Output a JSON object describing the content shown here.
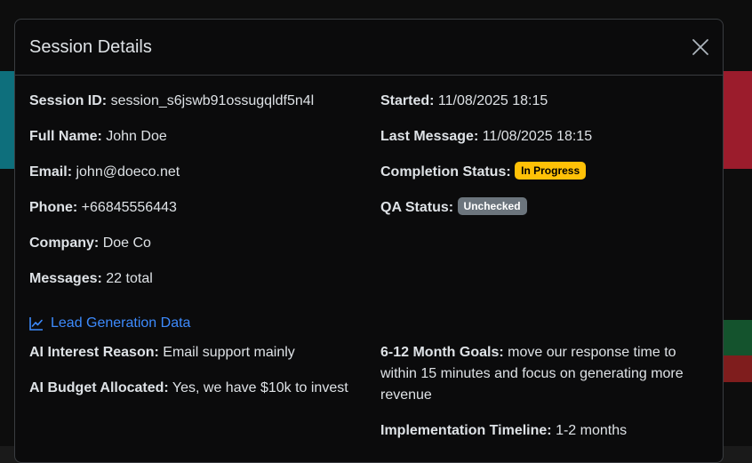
{
  "modal": {
    "title": "Session Details",
    "close_icon": "close-icon"
  },
  "session": {
    "id_label": "Session ID:",
    "id_value": "session_s6jswb91ossugqldf5n4l",
    "name_label": "Full Name:",
    "name_value": "John Doe",
    "email_label": "Email:",
    "email_value": "john@doeco.net",
    "phone_label": "Phone:",
    "phone_value": "+66845556443",
    "company_label": "Company:",
    "company_value": "Doe Co",
    "messages_label": "Messages:",
    "messages_value": "22 total",
    "started_label": "Started:",
    "started_value": "11/08/2025 18:15",
    "last_message_label": "Last Message:",
    "last_message_value": "11/08/2025 18:15",
    "completion_label": "Completion Status:",
    "completion_badge": "In Progress",
    "qa_label": "QA Status:",
    "qa_badge": "Unchecked"
  },
  "lead": {
    "section_title": "Lead Generation Data",
    "section_icon": "chart-line-icon",
    "interest_label": "AI Interest Reason:",
    "interest_value": "Email support mainly",
    "budget_label": "AI Budget Allocated:",
    "budget_value": "Yes, we have $10k to invest",
    "goals_label": "6-12 Month Goals:",
    "goals_value": "move our response time to within 15 minutes and focus on generating more revenue",
    "timeline_label": "Implementation Timeline:",
    "timeline_value": "1-2 months"
  },
  "colors": {
    "accent": "#3d8bfd",
    "warning": "#ffc107",
    "secondary": "#6c757d",
    "background": "#0b0b0c"
  }
}
